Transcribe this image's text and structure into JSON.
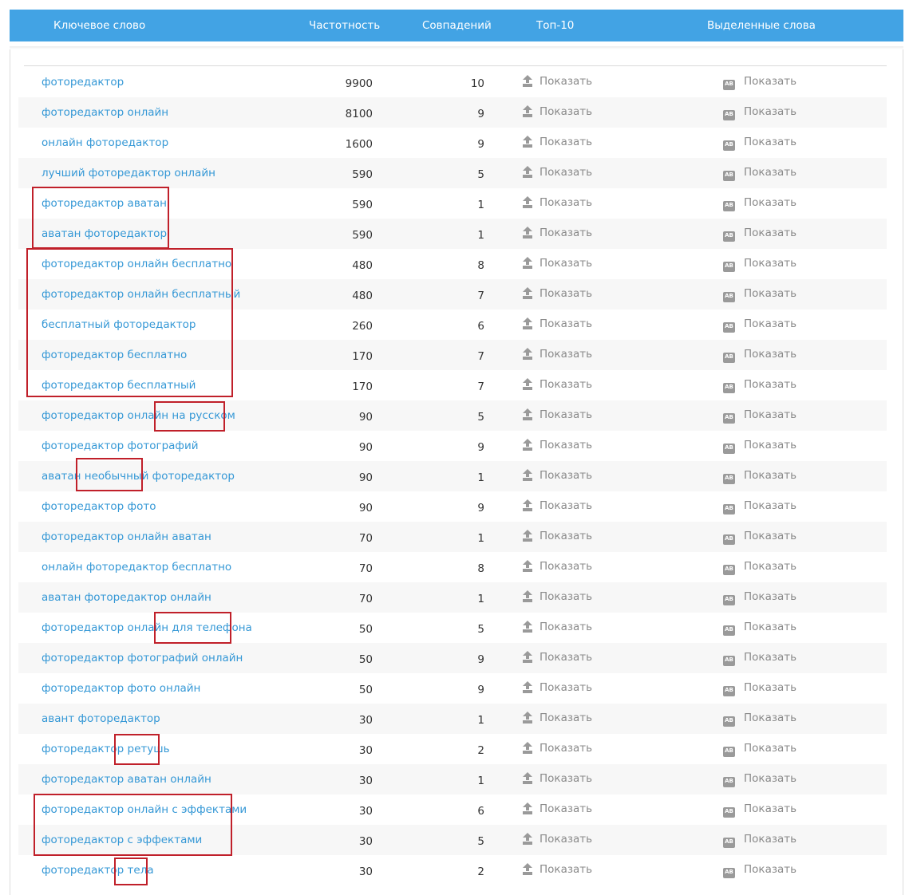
{
  "header": {
    "keyword": "Ключевое слово",
    "frequency": "Частотность",
    "matches": "Совпадений",
    "top10": "Топ-10",
    "highlighted": "Выделенные слова"
  },
  "actions": {
    "show": "Показать",
    "ab_glyph": "AB"
  },
  "colors": {
    "header": "#42a3e4",
    "link": "#3598d6",
    "highlight_box": "#c0202a"
  },
  "rows": [
    {
      "keyword": "фоторедактор",
      "frequency": "9900",
      "matches": "10"
    },
    {
      "keyword": "фоторедактор онлайн",
      "frequency": "8100",
      "matches": "9"
    },
    {
      "keyword": "онлайн фоторедактор",
      "frequency": "1600",
      "matches": "9"
    },
    {
      "keyword": "лучший фоторедактор онлайн",
      "frequency": "590",
      "matches": "5"
    },
    {
      "keyword": "фоторедактор аватан",
      "frequency": "590",
      "matches": "1"
    },
    {
      "keyword": "аватан фоторедактор",
      "frequency": "590",
      "matches": "1"
    },
    {
      "keyword": "фоторедактор онлайн бесплатно",
      "frequency": "480",
      "matches": "8"
    },
    {
      "keyword": "фоторедактор онлайн бесплатный",
      "frequency": "480",
      "matches": "7"
    },
    {
      "keyword": "бесплатный фоторедактор",
      "frequency": "260",
      "matches": "6"
    },
    {
      "keyword": "фоторедактор бесплатно",
      "frequency": "170",
      "matches": "7"
    },
    {
      "keyword": "фоторедактор бесплатный",
      "frequency": "170",
      "matches": "7"
    },
    {
      "keyword": "фоторедактор онлайн на русском",
      "frequency": "90",
      "matches": "5"
    },
    {
      "keyword": "фоторедактор фотографий",
      "frequency": "90",
      "matches": "9"
    },
    {
      "keyword": "аватан необычный фоторедактор",
      "frequency": "90",
      "matches": "1"
    },
    {
      "keyword": "фоторедактор фото",
      "frequency": "90",
      "matches": "9"
    },
    {
      "keyword": "фоторедактор онлайн аватан",
      "frequency": "70",
      "matches": "1"
    },
    {
      "keyword": "онлайн фоторедактор бесплатно",
      "frequency": "70",
      "matches": "8"
    },
    {
      "keyword": "аватан фоторедактор онлайн",
      "frequency": "70",
      "matches": "1"
    },
    {
      "keyword": "фоторедактор онлайн для телефона",
      "frequency": "50",
      "matches": "5"
    },
    {
      "keyword": "фоторедактор фотографий онлайн",
      "frequency": "50",
      "matches": "9"
    },
    {
      "keyword": "фоторедактор фото онлайн",
      "frequency": "50",
      "matches": "9"
    },
    {
      "keyword": "авант фоторедактор",
      "frequency": "30",
      "matches": "1"
    },
    {
      "keyword": "фоторедактор ретушь",
      "frequency": "30",
      "matches": "2"
    },
    {
      "keyword": "фоторедактор аватан онлайн",
      "frequency": "30",
      "matches": "1"
    },
    {
      "keyword": "фоторедактор онлайн с эффектами",
      "frequency": "30",
      "matches": "6"
    },
    {
      "keyword": "фоторедактор с эффектами",
      "frequency": "30",
      "matches": "5"
    },
    {
      "keyword": "фоторедактор тела",
      "frequency": "30",
      "matches": "2"
    }
  ]
}
